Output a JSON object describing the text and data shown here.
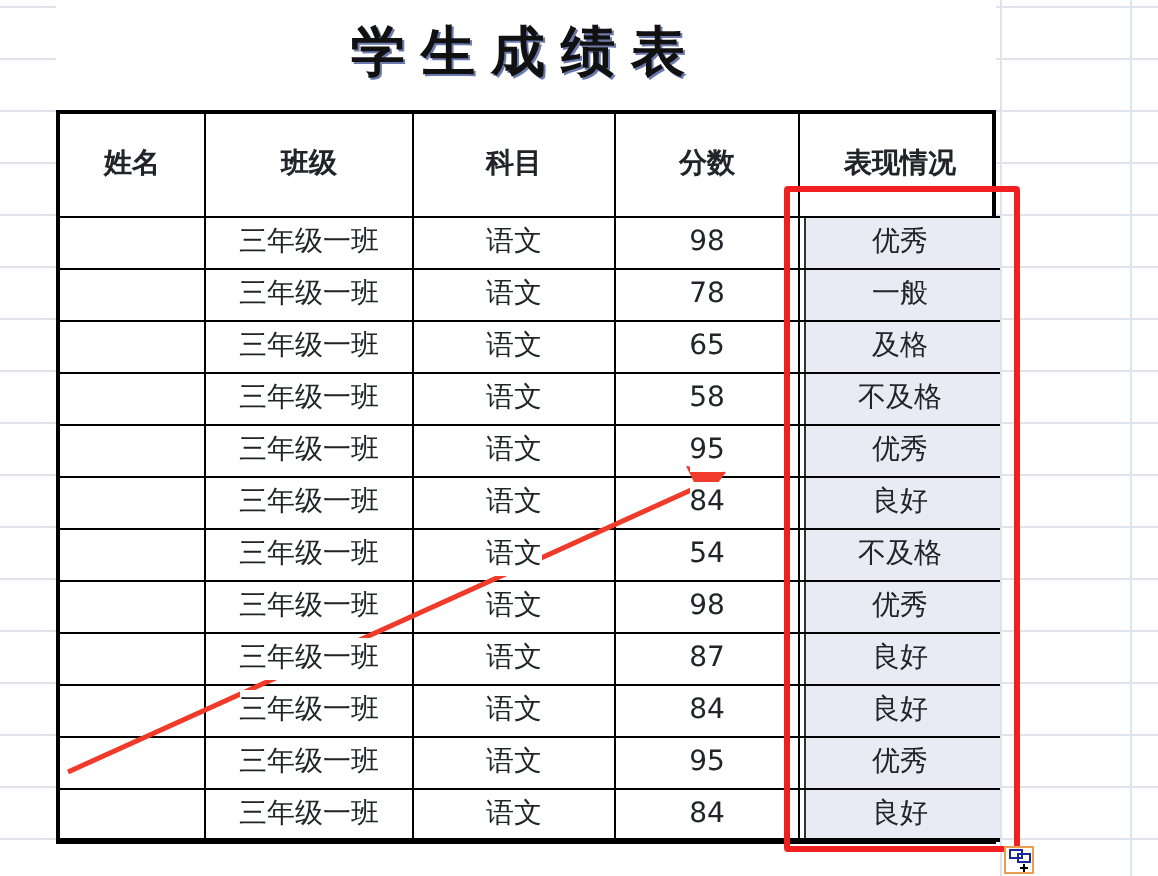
{
  "title": "学生成绩表",
  "columns": [
    {
      "label": "姓名",
      "selected": false
    },
    {
      "label": "班级",
      "selected": false
    },
    {
      "label": "科目",
      "selected": false
    },
    {
      "label": "分数",
      "selected": false
    },
    {
      "label": "表现情况",
      "selected": true
    }
  ],
  "rows": [
    {
      "class": "三年级一班",
      "subject": "语文",
      "score": "98",
      "rating": "优秀"
    },
    {
      "class": "三年级一班",
      "subject": "语文",
      "score": "78",
      "rating": "一般"
    },
    {
      "class": "三年级一班",
      "subject": "语文",
      "score": "65",
      "rating": "及格"
    },
    {
      "class": "三年级一班",
      "subject": "语文",
      "score": "58",
      "rating": "不及格"
    },
    {
      "class": "三年级一班",
      "subject": "语文",
      "score": "95",
      "rating": "优秀"
    },
    {
      "class": "三年级一班",
      "subject": "语文",
      "score": "84",
      "rating": "良好"
    },
    {
      "class": "三年级一班",
      "subject": "语文",
      "score": "54",
      "rating": "不及格"
    },
    {
      "class": "三年级一班",
      "subject": "语文",
      "score": "98",
      "rating": "优秀"
    },
    {
      "class": "三年级一班",
      "subject": "语文",
      "score": "87",
      "rating": "良好"
    },
    {
      "class": "三年级一班",
      "subject": "语文",
      "score": "84",
      "rating": "良好"
    },
    {
      "class": "三年级一班",
      "subject": "语文",
      "score": "95",
      "rating": "优秀"
    },
    {
      "class": "三年级一班",
      "subject": "语文",
      "score": "84",
      "rating": "良好"
    }
  ]
}
